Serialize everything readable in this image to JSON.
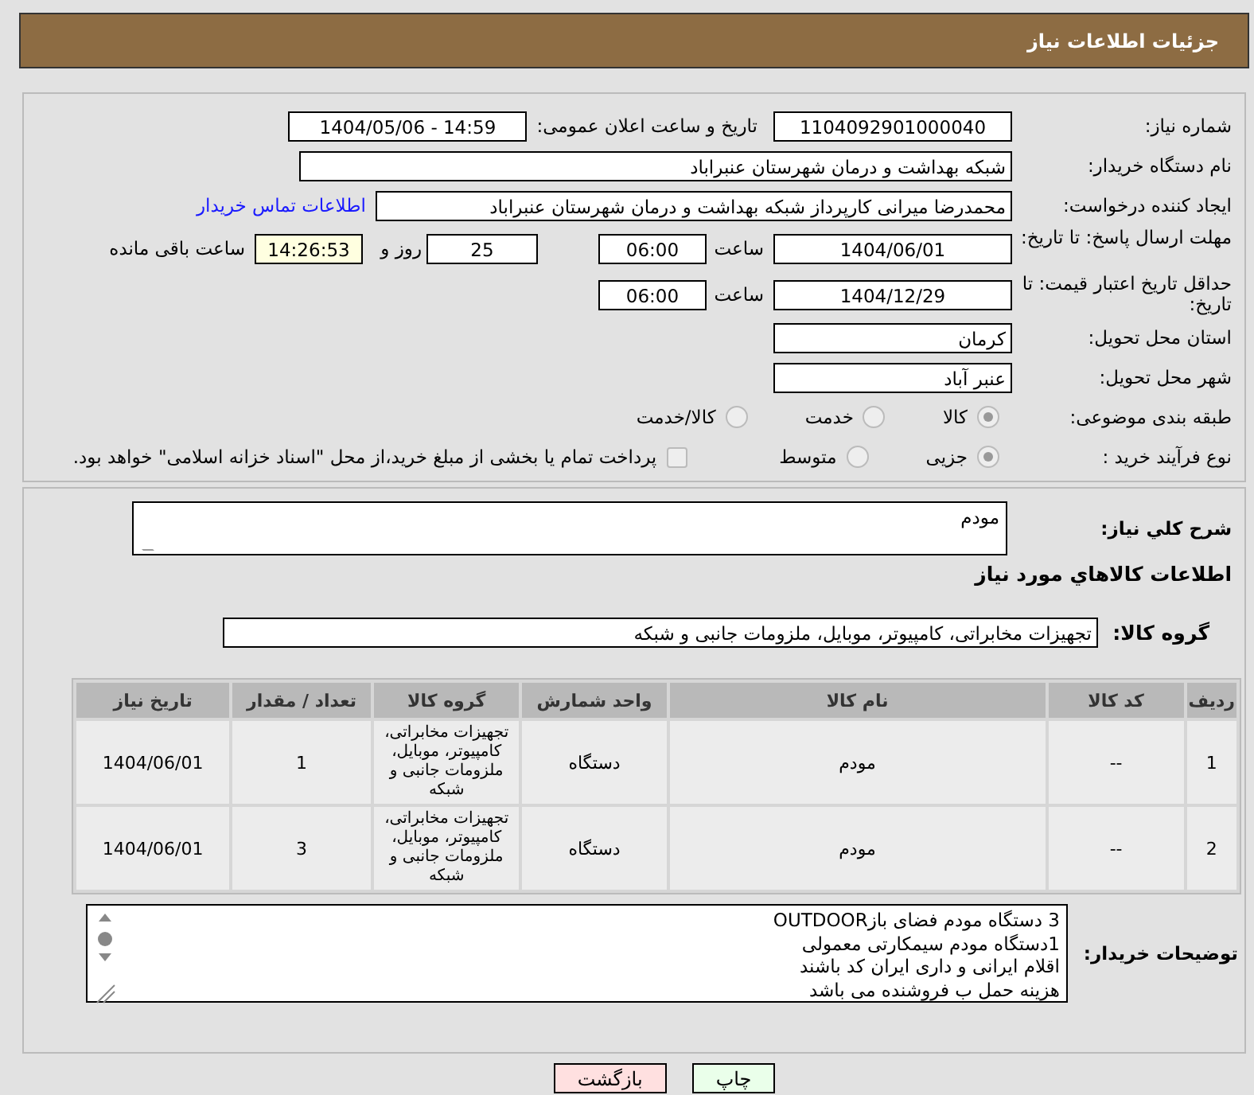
{
  "header": {
    "title": "جزئیات اطلاعات نیاز"
  },
  "fields": {
    "need_number_label": "شماره نیاز:",
    "need_number": "1104092901000040",
    "announce_label": "تاریخ و ساعت اعلان عمومی:",
    "announce": "1404/05/06 - 14:59",
    "buyer_label": "نام دستگاه خریدار:",
    "buyer": "شبکه بهداشت و درمان شهرستان عنبراباد",
    "creator_label": "ایجاد کننده درخواست:",
    "creator": "محمدرضا میرانی کارپرداز  شبکه بهداشت و درمان شهرستان عنبراباد",
    "contact_link": "اطلاعات تماس خریدار",
    "deadline_label": "مهلت ارسال پاسخ: تا تاریخ:",
    "deadline_date": "1404/06/01",
    "time_label": "ساعت",
    "deadline_time": "06:00",
    "days": "25",
    "days_label": "روز و",
    "remaining": "14:26:53",
    "remaining_label": "ساعت باقی مانده",
    "validity_label": "حداقل تاریخ اعتبار قیمت: تا تاریخ:",
    "validity_date": "1404/12/29",
    "validity_time_label": "ساعت",
    "validity_time": "06:00",
    "province_label": "استان محل تحویل:",
    "province": "کرمان",
    "city_label": "شهر محل تحویل:",
    "city": "عنبر آباد"
  },
  "category": {
    "label": "طبقه بندی موضوعی:",
    "options": [
      {
        "label": "کالا",
        "selected": true
      },
      {
        "label": "خدمت",
        "selected": false
      },
      {
        "label": "کالا/خدمت",
        "selected": false
      }
    ]
  },
  "process": {
    "label": "نوع فرآیند خرید :",
    "options": [
      {
        "label": "جزیی",
        "selected": true
      },
      {
        "label": "متوسط",
        "selected": false
      }
    ],
    "treasury": {
      "checked": false,
      "text": "پرداخت تمام یا بخشی از مبلغ خرید،از محل \"اسناد خزانه اسلامی\" خواهد بود."
    }
  },
  "description": {
    "label": "شرح کلي نیاز:",
    "value": "مودم"
  },
  "goods_heading": "اطلاعات کالاهاي مورد نیاز",
  "goods_group": {
    "label": "گروه کالا:",
    "value": "تجهیزات مخابراتی، کامپیوتر، موبایل، ملزومات جانبی و شبکه"
  },
  "table": {
    "columns": [
      "ردیف",
      "کد کالا",
      "نام کالا",
      "واحد شمارش",
      "گروه کالا",
      "تعداد / مقدار",
      "تاریخ نیاز"
    ],
    "rows": [
      [
        "1",
        "--",
        "مودم",
        "دستگاه",
        "تجهیزات مخابراتی، کامپیوتر، موبایل، ملزومات جانبی و شبکه",
        "1",
        "1404/06/01"
      ],
      [
        "2",
        "--",
        "مودم",
        "دستگاه",
        "تجهیزات مخابراتی، کامپیوتر، موبایل، ملزومات جانبی و شبکه",
        "3",
        "1404/06/01"
      ]
    ]
  },
  "buyer_notes": {
    "label": "توضیحات خریدار:",
    "lines": [
      "3 دستگاه مودم فضای بازOUTDOOR",
      "1دستگاه مودم سیمکارتی معمولی",
      "اقلام ایرانی و داری ایران کد باشند",
      "هزینه حمل ب فروشنده می باشد"
    ]
  },
  "buttons": [
    {
      "kind": "print",
      "label": "چاپ"
    },
    {
      "kind": "back",
      "label": "بازگشت"
    }
  ]
}
